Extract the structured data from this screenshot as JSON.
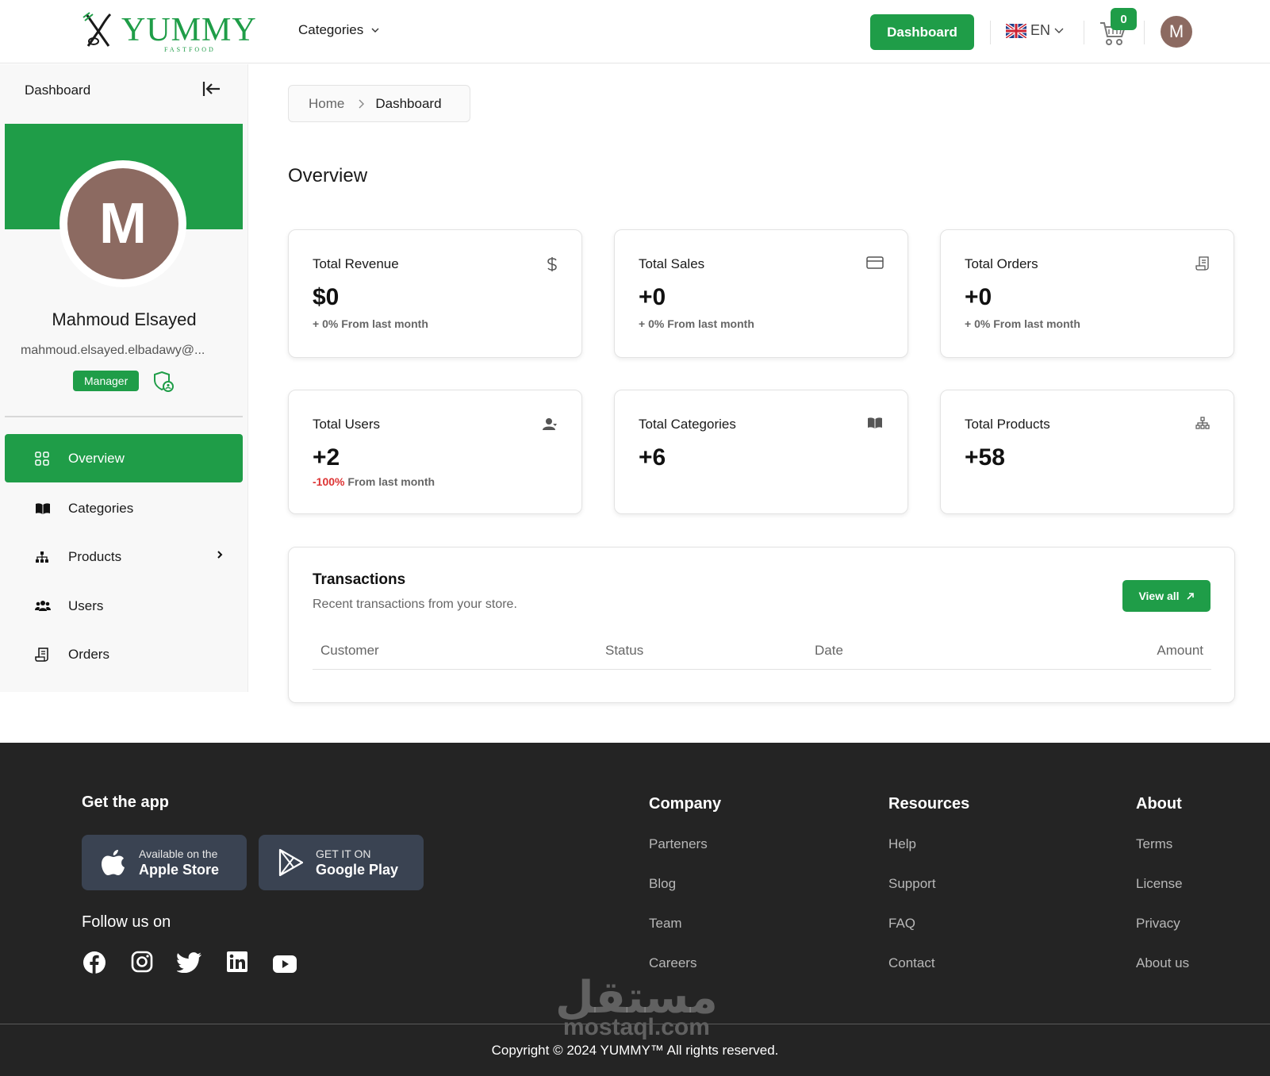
{
  "header": {
    "logo_word": "YUMMY",
    "logo_sub": "FASTFOOD",
    "nav_categories": "Categories",
    "dashboard_button": "Dashboard",
    "language": "EN",
    "cart_count": "0",
    "avatar_initial": "M"
  },
  "sidebar": {
    "title": "Dashboard",
    "avatar_initial": "M",
    "user_name": "Mahmoud Elsayed",
    "user_email": "mahmoud.elsayed.elbadawy@...",
    "role": "Manager",
    "items": [
      {
        "label": "Overview",
        "icon": "grid-icon",
        "active": true
      },
      {
        "label": "Categories",
        "icon": "book-open-icon"
      },
      {
        "label": "Products",
        "icon": "sitemap-icon",
        "has_submenu": true
      },
      {
        "label": "Users",
        "icon": "users-icon"
      },
      {
        "label": "Orders",
        "icon": "receipt-icon"
      }
    ]
  },
  "breadcrumb": {
    "home": "Home",
    "current": "Dashboard"
  },
  "page_title": "Overview",
  "cards": [
    {
      "label": "Total Revenue",
      "value": "$0",
      "note_prefix": "+ 0%",
      "note_suffix": " From last month",
      "icon": "dollar-icon"
    },
    {
      "label": "Total Sales",
      "value": "+0",
      "note_prefix": "+ 0%",
      "note_suffix": " From last month",
      "icon": "credit-card-icon"
    },
    {
      "label": "Total Orders",
      "value": "+0",
      "note_prefix": "+ 0%",
      "note_suffix": " From last month",
      "icon": "receipt-icon"
    },
    {
      "label": "Total Users",
      "value": "+2",
      "note_prefix": "-100%",
      "note_suffix": " From last month",
      "icon": "user-icon"
    },
    {
      "label": "Total Categories",
      "value": "+6",
      "icon": "book-open-icon"
    },
    {
      "label": "Total Products",
      "value": "+58",
      "icon": "sitemap-icon"
    }
  ],
  "transactions": {
    "title": "Transactions",
    "subtitle": "Recent transactions from your store.",
    "view_all": "View all",
    "columns": [
      "Customer",
      "Status",
      "Date",
      "Amount"
    ]
  },
  "footer": {
    "get_app": "Get the app",
    "apple_small": "Available on the",
    "apple_big": "Apple Store",
    "google_small": "GET IT ON",
    "google_big": "Google Play",
    "follow": "Follow us on",
    "social": [
      "facebook-icon",
      "instagram-icon",
      "twitter-icon",
      "linkedin-icon",
      "youtube-icon"
    ],
    "columns": [
      {
        "title": "Company",
        "links": [
          "Parteners",
          "Blog",
          "Team",
          "Careers"
        ]
      },
      {
        "title": "Resources",
        "links": [
          "Help",
          "Support",
          "FAQ",
          "Contact"
        ]
      },
      {
        "title": "About",
        "links": [
          "Terms",
          "License",
          "Privacy",
          "About us"
        ]
      }
    ],
    "copyright": "Copyright © 2024 YUMMY™ All rights reserved.",
    "watermark_ar": "مستقل",
    "watermark_lat": "mostaql.com"
  },
  "colors": {
    "accent": "#1f9d48",
    "negative": "#dd3333",
    "footer_bg": "#242424",
    "avatar_bg": "#8c6a61"
  }
}
